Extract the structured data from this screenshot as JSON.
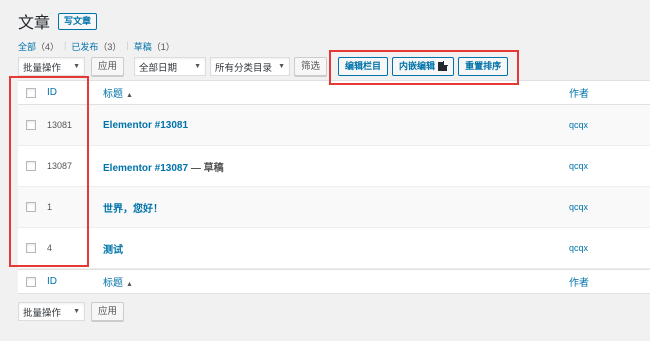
{
  "header": {
    "title": "文章",
    "add_new": "写文章"
  },
  "views": [
    {
      "label": "全部",
      "count": "（4）"
    },
    {
      "label": "已发布",
      "count": "（3）"
    },
    {
      "label": "草稿",
      "count": "（1）"
    }
  ],
  "tablenav_top": {
    "bulk_action": "批量操作",
    "apply": "应用",
    "date_filter": "全部日期",
    "category_filter": "所有分类目录",
    "filter_button": "筛选",
    "edit_columns": "编辑栏目",
    "inline_edit": "内嵌编辑",
    "reset_order": "重置排序"
  },
  "table": {
    "columns": {
      "id": "ID",
      "title": "标题",
      "author": "作者"
    },
    "rows": [
      {
        "id": "13081",
        "title": "Elementor #13081",
        "state": "",
        "author": "qcqx"
      },
      {
        "id": "13087",
        "title": "Elementor #13087",
        "state": " — 草稿",
        "author": "qcqx"
      },
      {
        "id": "1",
        "title": "世界，您好！",
        "state": "",
        "author": "qcqx"
      },
      {
        "id": "4",
        "title": "测试",
        "state": "",
        "author": "qcqx"
      }
    ]
  },
  "tablenav_bottom": {
    "bulk_action": "批量操作",
    "apply": "应用"
  },
  "colors": {
    "link": "#0073aa",
    "highlight": "#e53935",
    "background": "#f1f1f1"
  }
}
